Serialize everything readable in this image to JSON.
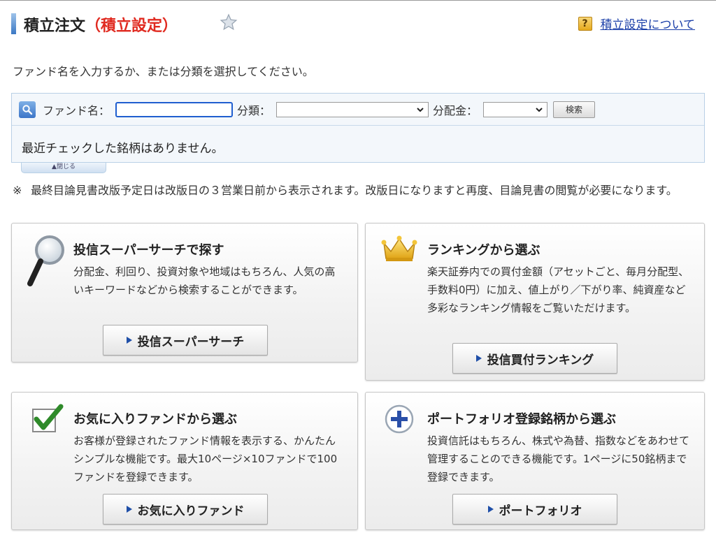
{
  "header": {
    "title_main": "積立注文",
    "title_sub": "（積立設定）",
    "help_link": "積立設定について",
    "help_icon_glyph": "?"
  },
  "instruction": "ファンド名を入力するか、または分類を選択してください。",
  "search": {
    "fund_label": "ファンド名：",
    "fund_value": "",
    "category_label": "分類：",
    "category_selected": "",
    "dividend_label": "分配金：",
    "dividend_selected": "",
    "search_button": "検索",
    "recent_message": "最近チェックした銘柄はありません。",
    "close_tab": "▲閉じる"
  },
  "note": {
    "mark": "※",
    "text": "最終目論見書改版予定日は改版日の３営業日前から表示されます。改版日になりますと再度、目論見書の閲覧が必要になります。"
  },
  "cards": [
    {
      "title": "投信スーパーサーチで探す",
      "desc": "分配金、利回り、投資対象や地域はもちろん、人気の高いキーワードなどから検索することができます。",
      "button": "投信スーパーサーチ",
      "icon": "magnifier-icon"
    },
    {
      "title": "ランキングから選ぶ",
      "desc": "楽天証券内での買付金額（アセットごと、毎月分配型、手数料0円）に加え、値上がり／下がり率、純資産など多彩なランキング情報をご覧いただけます。",
      "button": "投信買付ランキング",
      "icon": "crown-icon"
    },
    {
      "title": "お気に入りファンドから選ぶ",
      "desc": "お客様が登録されたファンド情報を表示する、かんたんシンプルな機能です。最大10ページ×10ファンドで100ファンドを登録できます。",
      "button": "お気に入りファンド",
      "icon": "checkbox-icon"
    },
    {
      "title": "ポートフォリオ登録銘柄から選ぶ",
      "desc": "投資信託はもちろん、株式や為替、指数などをあわせて管理することのできる機能です。1ページに50銘柄まで登録できます。",
      "button": "ポートフォリオ",
      "icon": "plus-circle-icon"
    }
  ],
  "colors": {
    "accent_red": "#e02a20",
    "link_blue": "#1a3ea8",
    "panel_bg": "#f3f7fb",
    "focus_blue": "#1f5ecf"
  }
}
